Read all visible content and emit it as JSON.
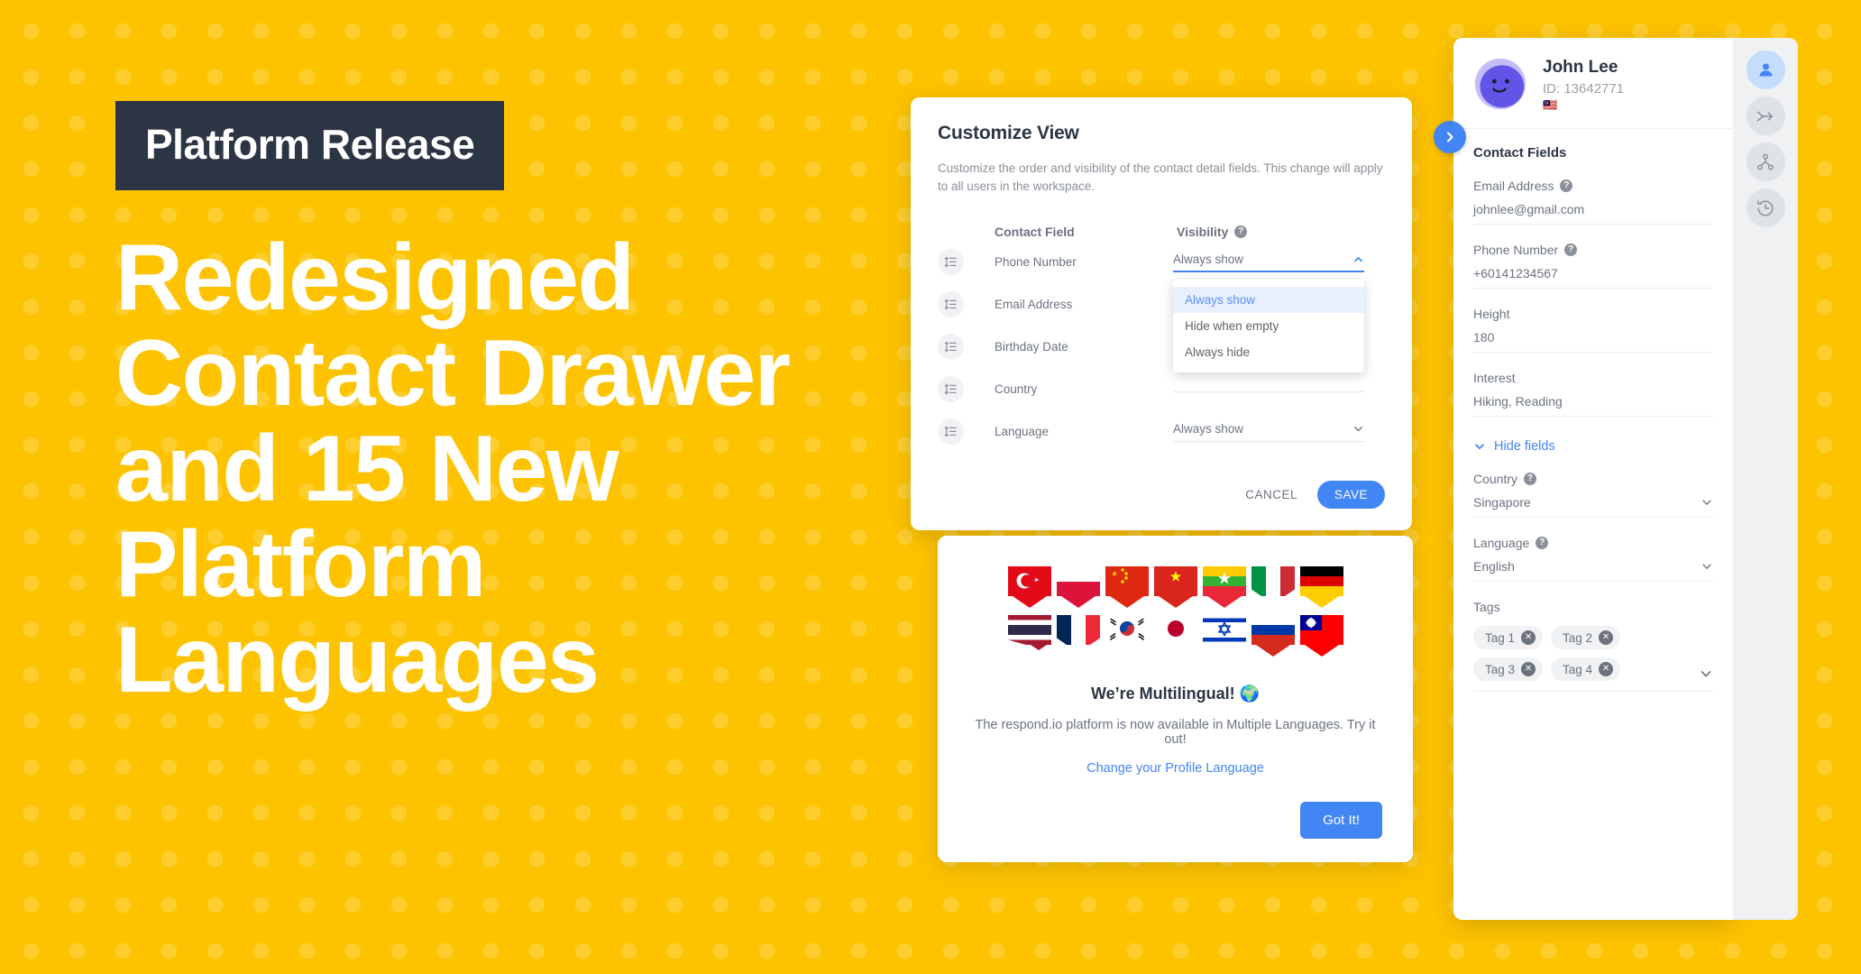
{
  "hero": {
    "badge": "Platform Release",
    "headline": "Redesigned Contact Drawer and 15 New Platform Languages"
  },
  "colors": {
    "background": "#FDC300",
    "badge_bg": "#2B3544",
    "accent_blue": "#4285f4",
    "dropdown_highlight": "#e8f0fe",
    "rail_bg": "#eff1f3"
  },
  "dialog": {
    "title": "Customize View",
    "description": "Customize the order and visibility of the contact detail fields. This change will apply to all users in the workspace.",
    "columns": {
      "field": "Contact Field",
      "visibility": "Visibility",
      "help_icon": "?"
    },
    "rows": [
      {
        "label": "Phone Number",
        "visibility": "Always show",
        "open": true,
        "drag_icon": "reorder-icon"
      },
      {
        "label": "Email Address",
        "visibility": "",
        "open": false,
        "drag_icon": "reorder-icon"
      },
      {
        "label": "Birthday Date",
        "visibility": "",
        "open": false,
        "drag_icon": "reorder-icon"
      },
      {
        "label": "Country",
        "visibility": "",
        "open": false,
        "drag_icon": "reorder-icon"
      },
      {
        "label": "Language",
        "visibility": "Always show",
        "open": false,
        "drag_icon": "reorder-icon"
      }
    ],
    "dropdown_options": [
      {
        "label": "Always show",
        "selected": true
      },
      {
        "label": "Hide when empty",
        "selected": false
      },
      {
        "label": "Always hide",
        "selected": false
      }
    ],
    "cancel_label": "CANCEL",
    "save_label": "SAVE"
  },
  "multilingual": {
    "title": "We’re Multilingual! 🌍",
    "subtitle": "The respond.io platform is now available in Multiple Languages. Try it out!",
    "link": "Change your Profile Language",
    "button": "Got It!",
    "flags_row1": [
      "Turkey",
      "Poland",
      "China",
      "Vietnam",
      "Myanmar",
      "Italy",
      "Germany"
    ],
    "flags_row2": [
      "Thailand",
      "France",
      "South Korea",
      "Japan",
      "Israel",
      "Russia",
      "Taiwan"
    ]
  },
  "drawer": {
    "contact": {
      "name": "John Lee",
      "id": "ID: 13642771",
      "flag": "🇲🇾",
      "avatar_icon": "avatar-blob-icon"
    },
    "section_title": "Contact Fields",
    "fields": [
      {
        "label": "Email Address",
        "value": "johnlee@gmail.com",
        "help": true,
        "type": "text"
      },
      {
        "label": "Phone Number",
        "value": "+60141234567",
        "help": true,
        "type": "text"
      },
      {
        "label": "Height",
        "value": "180",
        "help": false,
        "type": "text"
      },
      {
        "label": "Interest",
        "value": "Hiking, Reading",
        "help": false,
        "type": "text"
      }
    ],
    "hide_fields_label": "Hide fields",
    "hidden_fields": [
      {
        "label": "Country",
        "value": "Singapore",
        "help": true,
        "type": "select"
      },
      {
        "label": "Language",
        "value": "English",
        "help": true,
        "type": "select"
      }
    ],
    "tags_label": "Tags",
    "tags": [
      "Tag 1",
      "Tag 2",
      "Tag 3",
      "Tag 4"
    ],
    "toggle_icon": "chevron-right-icon"
  },
  "rail": {
    "items": [
      {
        "icon": "contact-person-icon",
        "active": true
      },
      {
        "icon": "arrow-forward-icon",
        "active": false
      },
      {
        "icon": "workflow-node-icon",
        "active": false
      },
      {
        "icon": "history-clock-icon",
        "active": false
      }
    ]
  }
}
